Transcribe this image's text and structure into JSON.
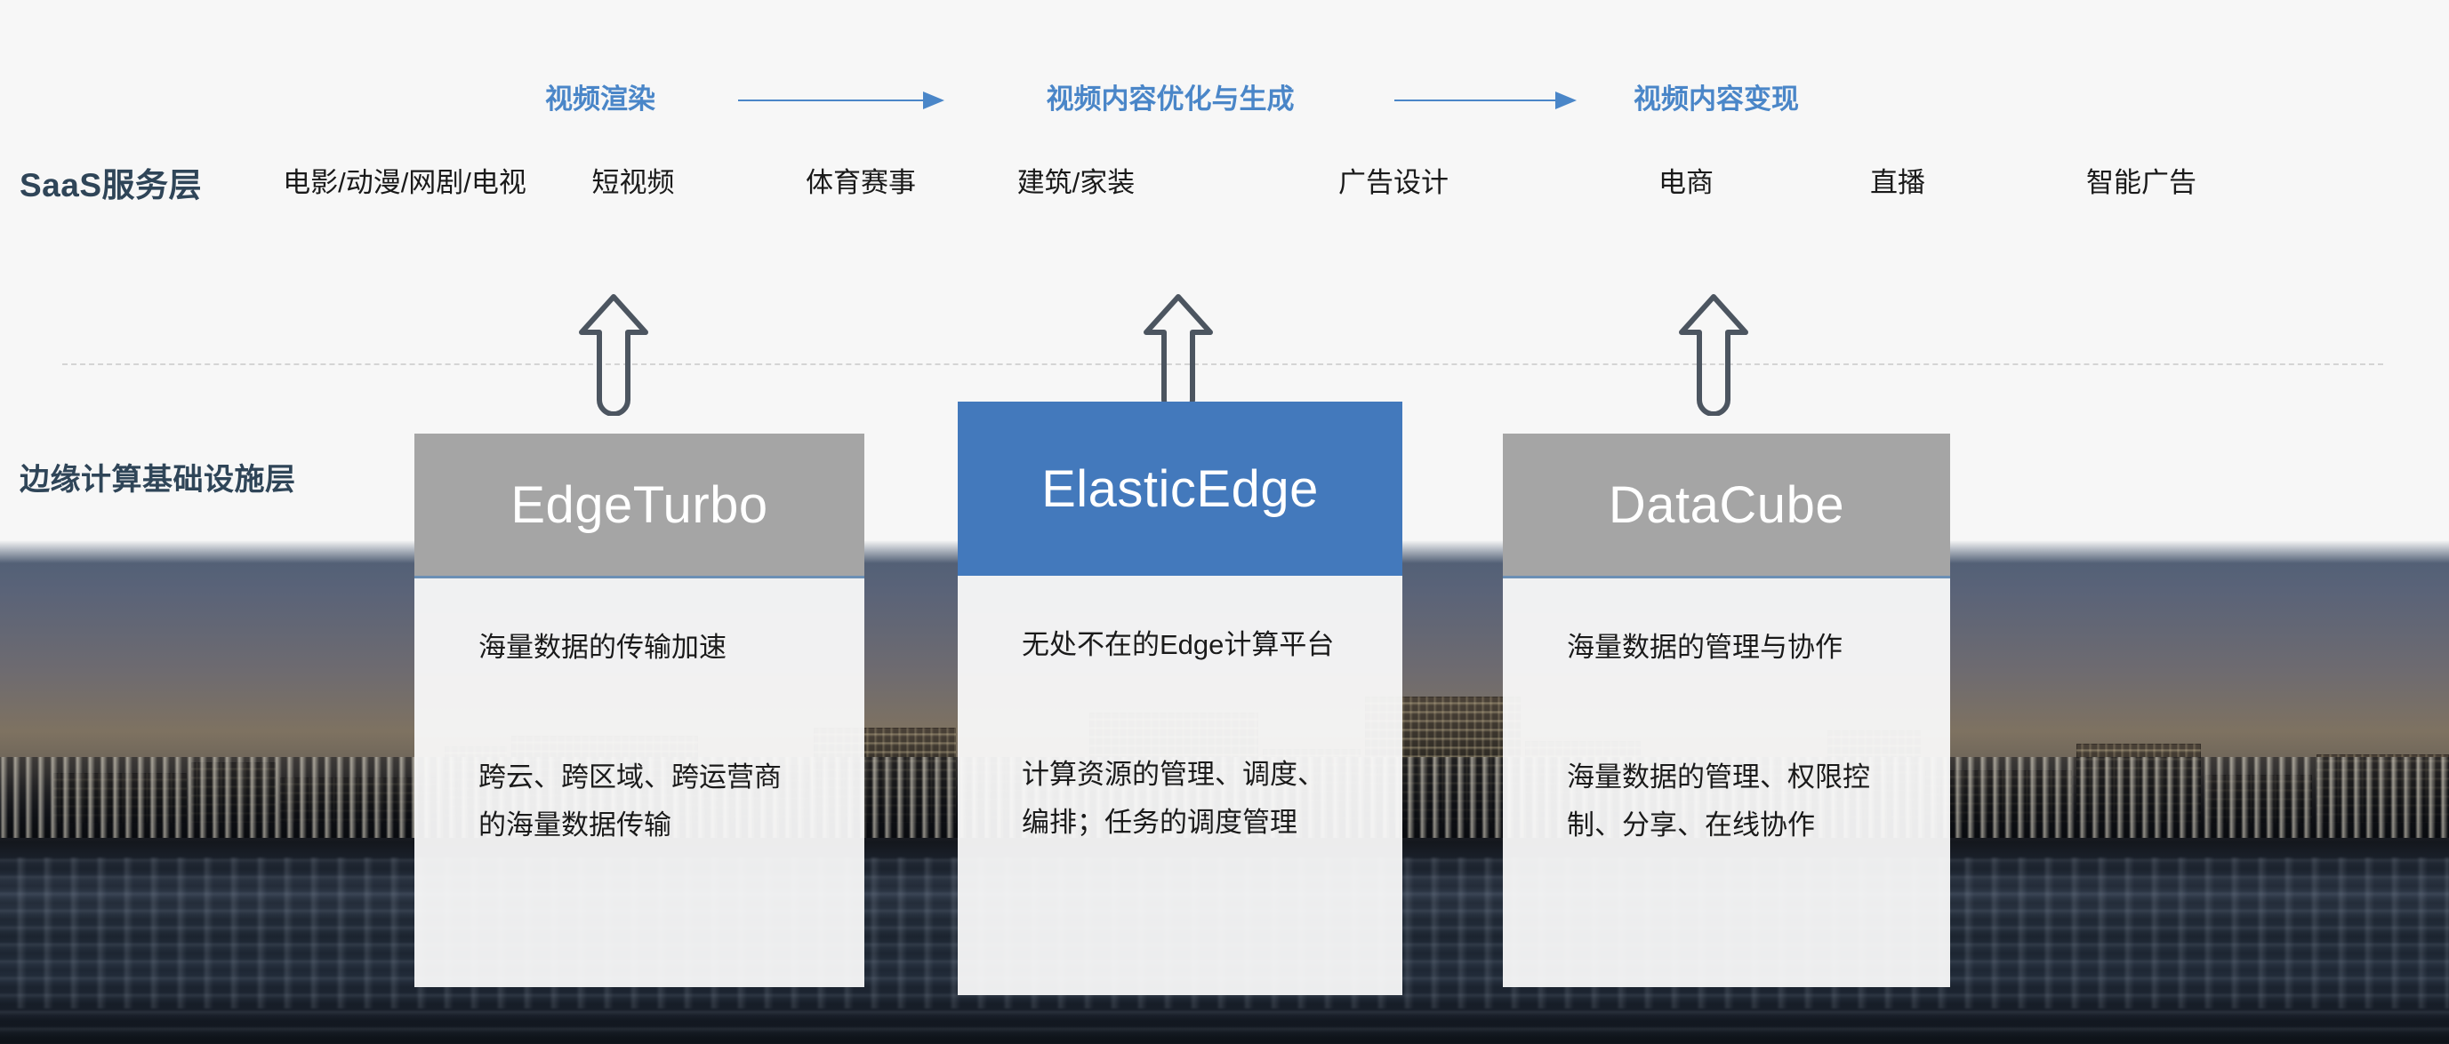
{
  "layers": {
    "saas_label": "SaaS服务层",
    "edge_label": "边缘计算基础设施层"
  },
  "flow": {
    "steps": [
      {
        "label": "视频渲染"
      },
      {
        "label": "视频内容优化与生成"
      },
      {
        "label": "视频内容变现"
      }
    ],
    "arrow_icon": "arrow-right-icon",
    "accent_color": "#4a86c8"
  },
  "saas_services": [
    {
      "label": "电影/动漫/网剧/电视"
    },
    {
      "label": "短视频"
    },
    {
      "label": "体育赛事"
    },
    {
      "label": "建筑/家装"
    },
    {
      "label": "广告设计"
    },
    {
      "label": "电商"
    },
    {
      "label": "直播"
    },
    {
      "label": "智能广告"
    }
  ],
  "connectors": [
    {
      "icon": "arrow-up-icon"
    },
    {
      "icon": "arrow-up-icon"
    },
    {
      "icon": "arrow-up-icon"
    }
  ],
  "products": [
    {
      "name": "EdgeTurbo",
      "title": "海量数据的传输加速",
      "description": "跨云、跨区域、跨运营商的海量数据传输",
      "header_color": "#a5a5a5",
      "highlighted": false
    },
    {
      "name": "ElasticEdge",
      "title": "无处不在的Edge计算平台",
      "description": "计算资源的管理、调度、编排；任务的调度管理",
      "header_color": "#4379bc",
      "highlighted": true
    },
    {
      "name": "DataCube",
      "title": "海量数据的管理与协作",
      "description": "海量数据的管理、权限控制、分享、在线协作",
      "header_color": "#a5a5a5",
      "highlighted": false
    }
  ],
  "background": {
    "image_name": "city-skyline-night-photo"
  }
}
